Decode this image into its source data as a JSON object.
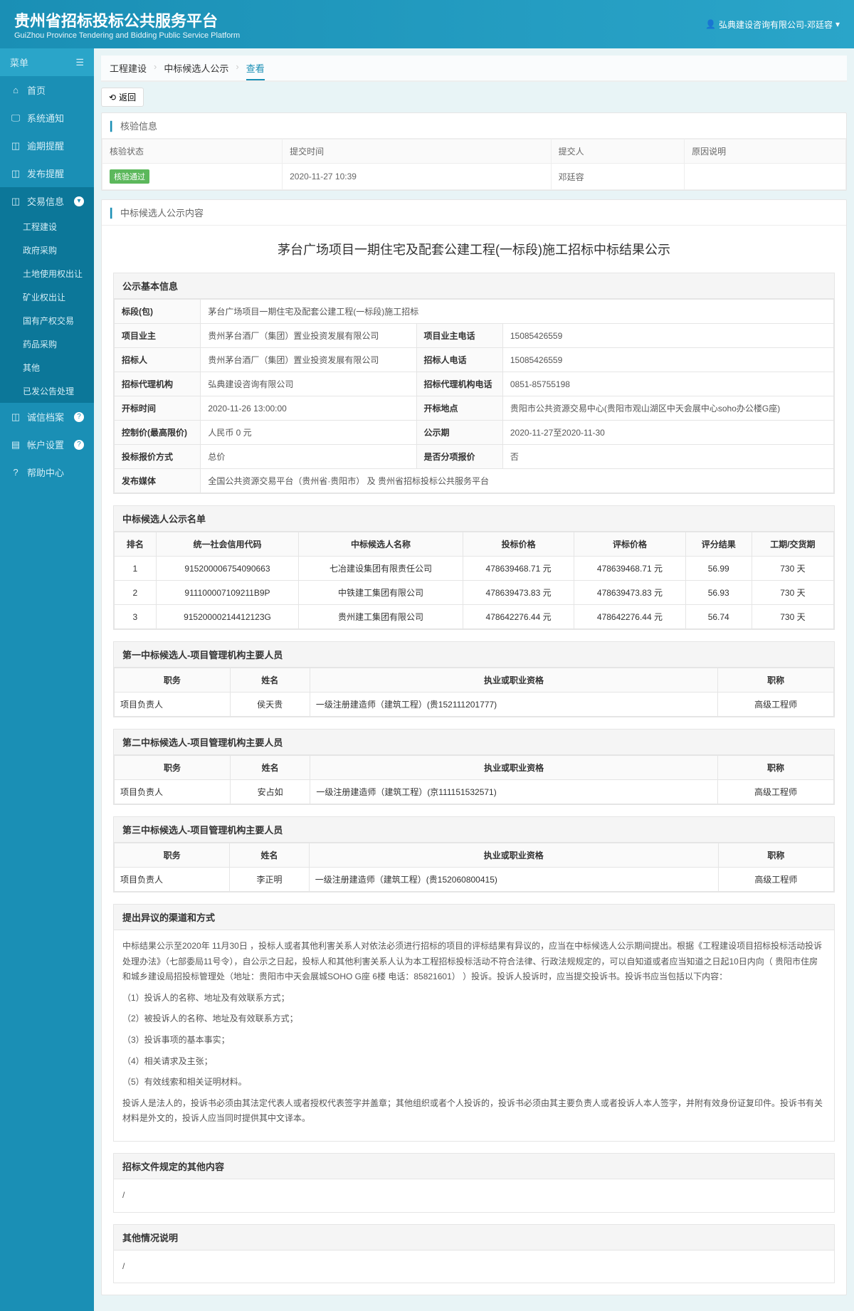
{
  "header": {
    "title": "贵州省招标投标公共服务平台",
    "subtitle": "GuiZhou Province Tendering and Bidding Public Service Platform",
    "user": "弘典建设咨询有限公司-邓廷容"
  },
  "sidebar": {
    "menuLabel": "菜单",
    "items": [
      {
        "icon": "⌂",
        "label": "首页"
      },
      {
        "icon": "🖵",
        "label": "系统通知"
      },
      {
        "icon": "◫",
        "label": "逾期提醒"
      },
      {
        "icon": "◫",
        "label": "发布提醒"
      },
      {
        "icon": "◫",
        "label": "交易信息",
        "active": true,
        "badge": "▾"
      }
    ],
    "submenu": [
      "工程建设",
      "政府采购",
      "土地使用权出让",
      "矿业权出让",
      "国有产权交易",
      "药品采购",
      "其他",
      "已发公告处理"
    ],
    "bottomItems": [
      {
        "icon": "◫",
        "label": "诚信档案",
        "badge": "?"
      },
      {
        "icon": "▤",
        "label": "帐户设置",
        "badge": "?"
      },
      {
        "icon": "?",
        "label": "帮助中心"
      }
    ]
  },
  "breadcrumb": [
    "工程建设",
    "中标候选人公示",
    "查看"
  ],
  "backLabel": "返回",
  "checkInfo": {
    "title": "核验信息",
    "headers": [
      "核验状态",
      "提交时间",
      "提交人",
      "原因说明"
    ],
    "row": {
      "status": "核验通过",
      "time": "2020-11-27 10:39",
      "submitter": "邓廷容",
      "reason": ""
    }
  },
  "contentTitle": "中标候选人公示内容",
  "noticeTitle": "茅台广场项目一期住宅及配套公建工程(一标段)施工招标中标结果公示",
  "basicInfo": {
    "title": "公示基本信息",
    "rows": [
      [
        {
          "k": "标段(包)",
          "v": "茅台广场项目一期住宅及配套公建工程(一标段)施工招标",
          "span": 3
        }
      ],
      [
        {
          "k": "项目业主",
          "v": "贵州茅台酒厂（集团）置业投资发展有限公司"
        },
        {
          "k": "项目业主电话",
          "v": "15085426559"
        }
      ],
      [
        {
          "k": "招标人",
          "v": "贵州茅台酒厂（集团）置业投资发展有限公司"
        },
        {
          "k": "招标人电话",
          "v": "15085426559"
        }
      ],
      [
        {
          "k": "招标代理机构",
          "v": "弘典建设咨询有限公司"
        },
        {
          "k": "招标代理机构电话",
          "v": "0851-85755198"
        }
      ],
      [
        {
          "k": "开标时间",
          "v": "2020-11-26 13:00:00"
        },
        {
          "k": "开标地点",
          "v": "贵阳市公共资源交易中心(贵阳市观山湖区中天会展中心soho办公楼G座)"
        }
      ],
      [
        {
          "k": "控制价(最高限价)",
          "v": "人民币 0 元"
        },
        {
          "k": "公示期",
          "v": "2020-11-27至2020-11-30"
        }
      ],
      [
        {
          "k": "投标报价方式",
          "v": "总价"
        },
        {
          "k": "是否分项报价",
          "v": "否"
        }
      ],
      [
        {
          "k": "发布媒体",
          "v": "全国公共资源交易平台（贵州省·贵阳市） 及 贵州省招标投标公共服务平台",
          "span": 3
        }
      ]
    ]
  },
  "candidateList": {
    "title": "中标候选人公示名单",
    "headers": [
      "排名",
      "统一社会信用代码",
      "中标候选人名称",
      "投标价格",
      "评标价格",
      "评分结果",
      "工期/交货期"
    ],
    "rows": [
      [
        "1",
        "915200006754090663",
        "七冶建设集团有限责任公司",
        "478639468.71 元",
        "478639468.71 元",
        "56.99",
        "730 天"
      ],
      [
        "2",
        "911100007109211B9P",
        "中铁建工集团有限公司",
        "478639473.83 元",
        "478639473.83 元",
        "56.93",
        "730 天"
      ],
      [
        "3",
        "91520000214412123G",
        "贵州建工集团有限公司",
        "478642276.44 元",
        "478642276.44 元",
        "56.74",
        "730 天"
      ]
    ]
  },
  "personnel": [
    {
      "title": "第一中标候选人-项目管理机构主要人员",
      "headers": [
        "职务",
        "姓名",
        "执业或职业资格",
        "职称"
      ],
      "rows": [
        [
          "项目负责人",
          "侯天贵",
          "一级注册建造师（建筑工程）(贵152111201777)",
          "高级工程师"
        ]
      ]
    },
    {
      "title": "第二中标候选人-项目管理机构主要人员",
      "headers": [
        "职务",
        "姓名",
        "执业或职业资格",
        "职称"
      ],
      "rows": [
        [
          "项目负责人",
          "安占如",
          "一级注册建造师（建筑工程）(京111151532571)",
          "高级工程师"
        ]
      ]
    },
    {
      "title": "第三中标候选人-项目管理机构主要人员",
      "headers": [
        "职务",
        "姓名",
        "执业或职业资格",
        "职称"
      ],
      "rows": [
        [
          "项目负责人",
          "李正明",
          "一级注册建造师（建筑工程）(贵152060800415)",
          "高级工程师"
        ]
      ]
    }
  ],
  "objection": {
    "title": "提出异议的渠道和方式",
    "para1": "中标结果公示至2020年 11月30日 ，投标人或者其他利害关系人对依法必须进行招标的项目的评标结果有异议的，应当在中标候选人公示期间提出。根据《工程建设项目招标投标活动投诉处理办法》（七部委局11号令），自公示之日起，投标人和其他利害关系人认为本工程招标投标活动不符合法律、行政法规规定的，可以自知道或者应当知道之日起10日内向（ 贵阳市住房和城乡建设局招投标管理处（地址：贵阳市中天会展城SOHO G座 6楼  电话：85821601） ）投诉。投诉人投诉时，应当提交投诉书。投诉书应当包括以下内容：",
    "items": [
      "（1）投诉人的名称、地址及有效联系方式；",
      "（2）被投诉人的名称、地址及有效联系方式；",
      "（3）投诉事项的基本事实；",
      "（4）相关请求及主张；",
      "（5）有效线索和相关证明材料。"
    ],
    "para2": "投诉人是法人的，投诉书必须由其法定代表人或者授权代表签字并盖章；其他组织或者个人投诉的，投诉书必须由其主要负责人或者投诉人本人签字，并附有效身份证复印件。投诉书有关材料是外文的，投诉人应当同时提供其中文译本。"
  },
  "otherSections": [
    {
      "title": "招标文件规定的其他内容",
      "body": "/"
    },
    {
      "title": "其他情况说明",
      "body": "/"
    }
  ]
}
